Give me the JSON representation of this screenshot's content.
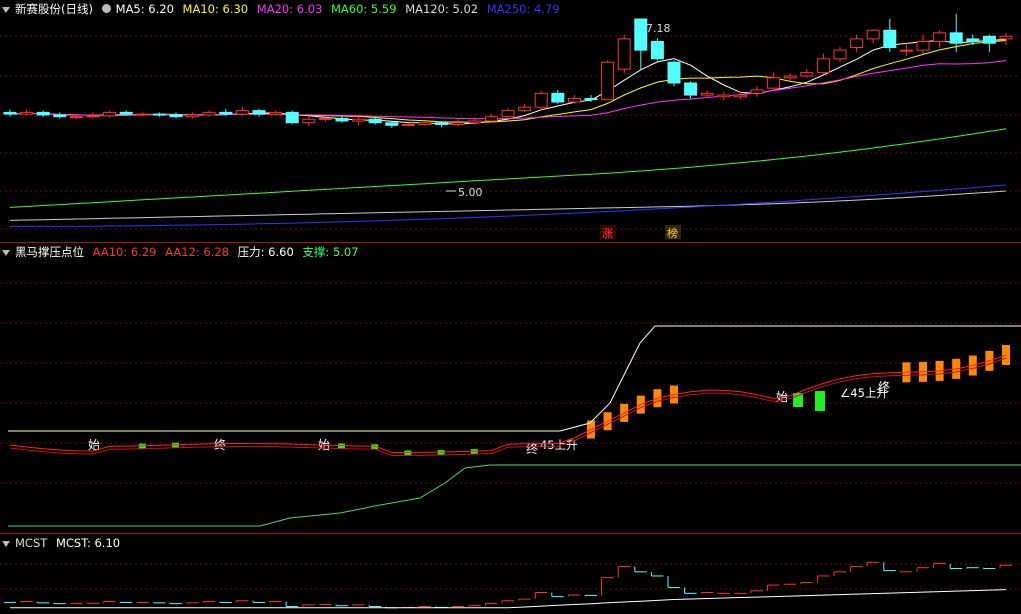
{
  "pane1": {
    "title": "新赛股份(日线)",
    "ma": [
      {
        "label": "MA5: 6.20",
        "color": "#ffffff"
      },
      {
        "label": "MA10: 6.30",
        "color": "#ffff00"
      },
      {
        "label": "MA20: 6.03",
        "color": "#ff33ff"
      },
      {
        "label": "MA60: 5.59",
        "color": "#33ff33"
      },
      {
        "label": "MA120: 5.02",
        "color": "#dddddd"
      },
      {
        "label": "MA250: 4.79",
        "color": "#3333ff"
      }
    ],
    "high_label": "7.18",
    "low_label": "5.00",
    "tag_zhang": "涨",
    "tag_bang": "榜"
  },
  "pane2": {
    "title": "黑马撑压点位",
    "fields": [
      {
        "label": "AA10: 6.29",
        "color": "#ff3333"
      },
      {
        "label": "AA12: 6.28",
        "color": "#ff3333"
      },
      {
        "label": "压力: 6.60",
        "color": "#ffffff"
      },
      {
        "label": "支撑: 5.07",
        "color": "#33ff66"
      }
    ],
    "shi": "始",
    "zhong": "终",
    "rise": "45上升",
    "rise_angle": "∠45上升"
  },
  "pane3": {
    "title": "MCST",
    "value": "MCST: 6.10"
  },
  "chart_data": [
    {
      "type": "candlestick",
      "title": "新赛股份(日线)",
      "ylim": [
        4.6,
        7.4
      ],
      "candles": [
        [
          6.1,
          6.08,
          6.13,
          6.05
        ],
        [
          6.08,
          6.1,
          6.13,
          6.06
        ],
        [
          6.1,
          6.07,
          6.12,
          6.05
        ],
        [
          6.07,
          6.05,
          6.1,
          6.03
        ],
        [
          6.05,
          6.05,
          6.08,
          6.02
        ],
        [
          6.05,
          6.06,
          6.1,
          6.03
        ],
        [
          6.06,
          6.1,
          6.12,
          6.04
        ],
        [
          6.1,
          6.08,
          6.12,
          6.06
        ],
        [
          6.08,
          6.08,
          6.1,
          6.06
        ],
        [
          6.08,
          6.07,
          6.1,
          6.05
        ],
        [
          6.07,
          6.05,
          6.1,
          6.03
        ],
        [
          6.05,
          6.07,
          6.1,
          6.03
        ],
        [
          6.07,
          6.1,
          6.12,
          6.05
        ],
        [
          6.1,
          6.08,
          6.14,
          6.06
        ],
        [
          6.08,
          6.12,
          6.16,
          6.06
        ],
        [
          6.12,
          6.08,
          6.14,
          6.05
        ],
        [
          6.08,
          6.1,
          6.12,
          6.06
        ],
        [
          6.1,
          5.98,
          6.12,
          5.96
        ],
        [
          5.98,
          6.02,
          6.05,
          5.94
        ],
        [
          6.02,
          6.03,
          6.06,
          5.99
        ],
        [
          6.03,
          6.0,
          6.05,
          5.98
        ],
        [
          6.0,
          6.02,
          6.05,
          5.95
        ],
        [
          6.02,
          5.98,
          6.04,
          5.96
        ],
        [
          5.98,
          5.95,
          6.0,
          5.92
        ],
        [
          5.95,
          5.96,
          5.98,
          5.94
        ],
        [
          5.96,
          5.98,
          6.0,
          5.95
        ],
        [
          5.98,
          5.96,
          6.0,
          5.93
        ],
        [
          5.96,
          5.98,
          6.02,
          5.94
        ],
        [
          5.98,
          6.0,
          6.04,
          5.96
        ],
        [
          6.0,
          6.05,
          6.08,
          5.98
        ],
        [
          6.05,
          6.12,
          6.15,
          6.02
        ],
        [
          6.12,
          6.16,
          6.2,
          6.1
        ],
        [
          6.16,
          6.32,
          6.35,
          6.14
        ],
        [
          6.32,
          6.22,
          6.36,
          6.2
        ],
        [
          6.22,
          6.26,
          6.3,
          6.2
        ],
        [
          6.26,
          6.25,
          6.3,
          6.22
        ],
        [
          6.25,
          6.68,
          6.7,
          6.24
        ],
        [
          6.6,
          6.95,
          7.0,
          6.55
        ],
        [
          7.18,
          6.82,
          7.18,
          6.6
        ],
        [
          6.92,
          6.72,
          6.96,
          6.7
        ],
        [
          6.68,
          6.44,
          6.7,
          6.4
        ],
        [
          6.44,
          6.3,
          6.46,
          6.26
        ],
        [
          6.3,
          6.32,
          6.35,
          6.28
        ],
        [
          6.28,
          6.3,
          6.34,
          6.24
        ],
        [
          6.28,
          6.3,
          6.34,
          6.25
        ],
        [
          6.32,
          6.36,
          6.4,
          6.28
        ],
        [
          6.38,
          6.5,
          6.56,
          6.35
        ],
        [
          6.5,
          6.52,
          6.55,
          6.46
        ],
        [
          6.52,
          6.56,
          6.6,
          6.5
        ],
        [
          6.56,
          6.72,
          6.78,
          6.54
        ],
        [
          6.72,
          6.82,
          6.86,
          6.68
        ],
        [
          6.85,
          6.95,
          7.0,
          6.8
        ],
        [
          6.95,
          7.05,
          7.06,
          6.9
        ],
        [
          7.05,
          6.85,
          7.18,
          6.8
        ],
        [
          6.82,
          6.82,
          6.9,
          6.75
        ],
        [
          6.82,
          6.92,
          7.0,
          6.78
        ],
        [
          6.92,
          7.02,
          7.05,
          6.85
        ],
        [
          7.02,
          6.9,
          7.24,
          6.8
        ],
        [
          6.95,
          6.92,
          7.0,
          6.88
        ],
        [
          6.98,
          6.9,
          7.0,
          6.8
        ],
        [
          6.95,
          6.98,
          7.02,
          6.88
        ]
      ]
    }
  ]
}
